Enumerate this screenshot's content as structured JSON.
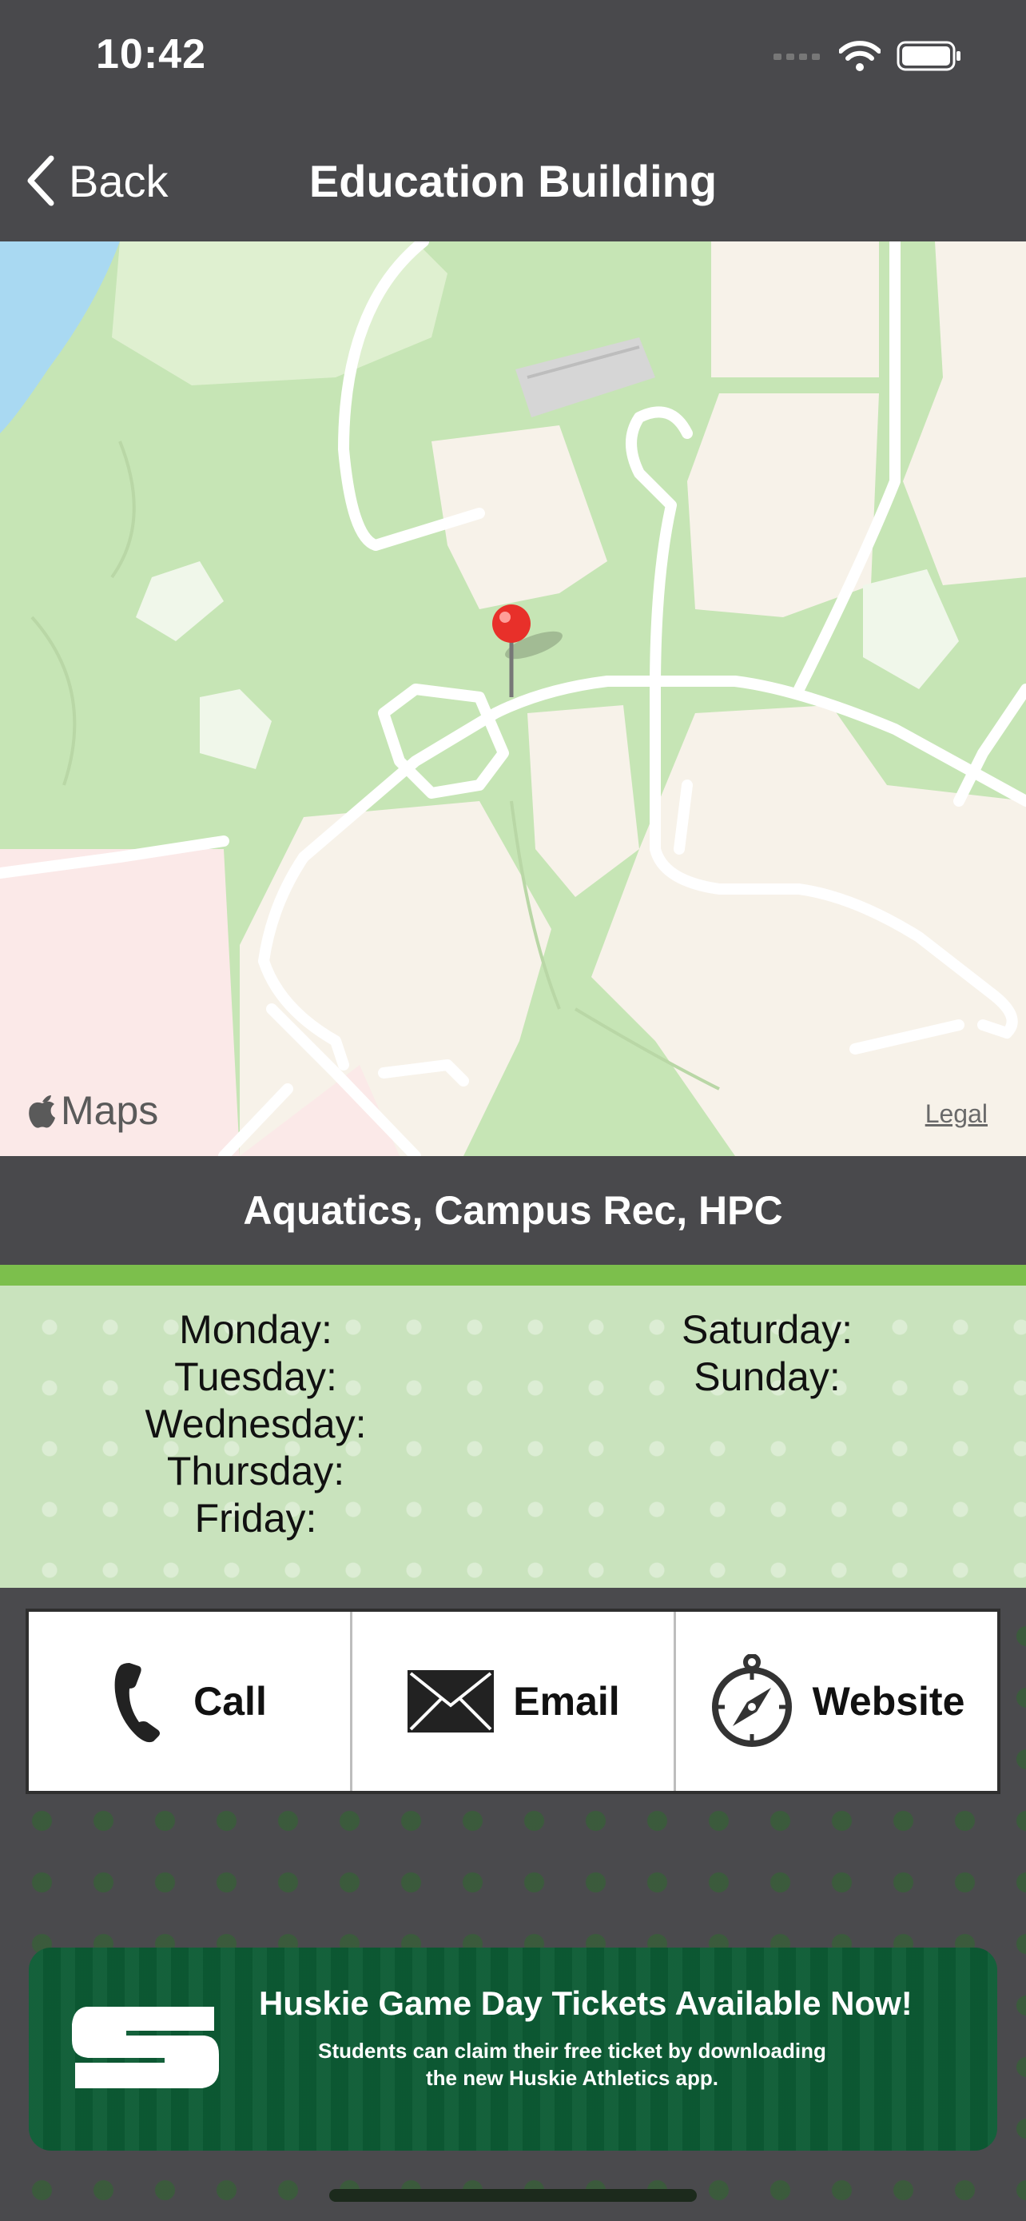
{
  "status": {
    "time": "10:42"
  },
  "nav": {
    "back_label": "Back",
    "title": "Education Building"
  },
  "map": {
    "brand": "Maps",
    "legal": "Legal"
  },
  "location": {
    "name": "Aquatics, Campus Rec, HPC"
  },
  "hours": {
    "weekdays": [
      "Monday:",
      "Tuesday:",
      "Wednesday:",
      "Thursday:",
      "Friday:"
    ],
    "weekend": [
      "Saturday:",
      "Sunday:"
    ]
  },
  "actions": {
    "call": "Call",
    "email": "Email",
    "website": "Website"
  },
  "banner": {
    "headline": "Huskie Game Day Tickets Available Now!",
    "subline1": "Students can claim their free ticket by downloading",
    "subline2": "the new Huskie Athletics app."
  },
  "colors": {
    "header": "#49494c",
    "accent_green": "#7cbf4c",
    "hours_bg": "#c9e3bd",
    "banner": "#0d5c35",
    "pin": "#e8302a"
  }
}
